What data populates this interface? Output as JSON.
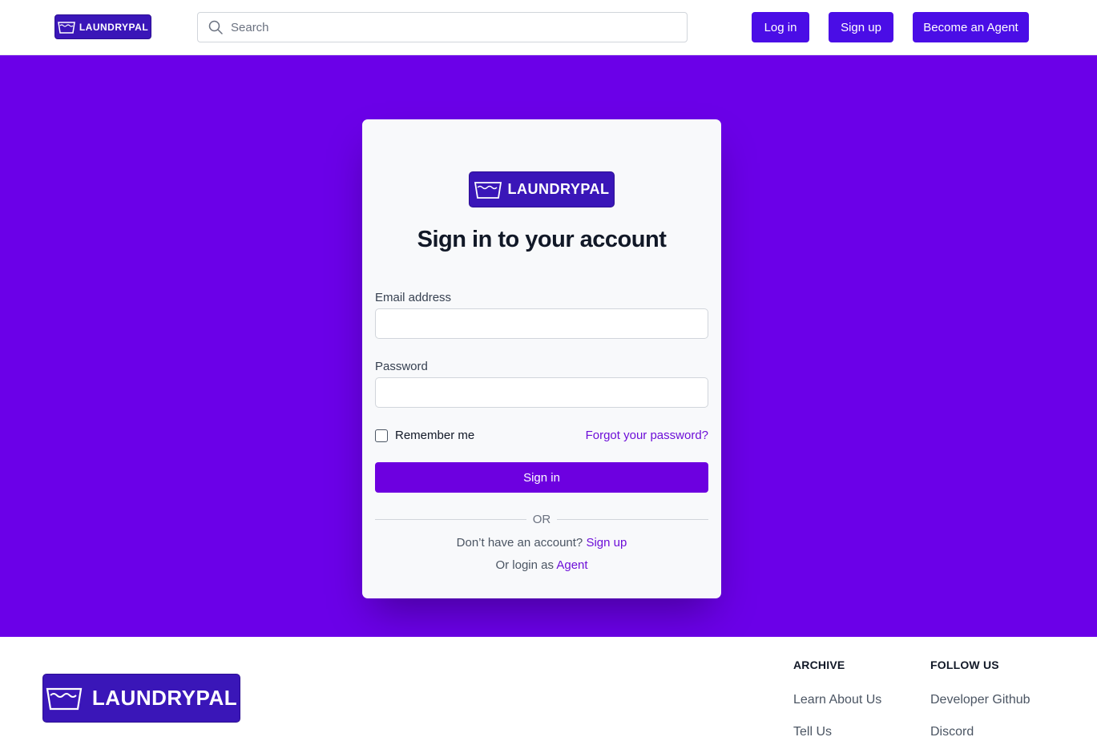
{
  "brand": {
    "name": "LAUNDRYPAL",
    "logo_color": "#3a16b8",
    "accent": "#6b00e8"
  },
  "header": {
    "search": {
      "placeholder": "Search"
    },
    "login_label": "Log in",
    "signup_label": "Sign up",
    "agent_label": "Become an Agent"
  },
  "signin_card": {
    "title": "Sign in to your account",
    "email_label": "Email address",
    "email_value": "",
    "password_label": "Password",
    "password_value": "",
    "remember_label": "Remember me",
    "remember_checked": false,
    "forgot_label": "Forgot your password?",
    "submit_label": "Sign in",
    "divider_label": "OR",
    "no_account_text": "Don’t have an account?",
    "signup_link": "Sign up",
    "agent_text": "Or login as",
    "agent_link": "Agent"
  },
  "footer": {
    "archive": {
      "heading": "ARCHIVE",
      "links": [
        "Learn About Us",
        "Tell Us"
      ]
    },
    "follow": {
      "heading": "FOLLOW US",
      "links": [
        "Developer Github",
        "Discord"
      ]
    }
  }
}
